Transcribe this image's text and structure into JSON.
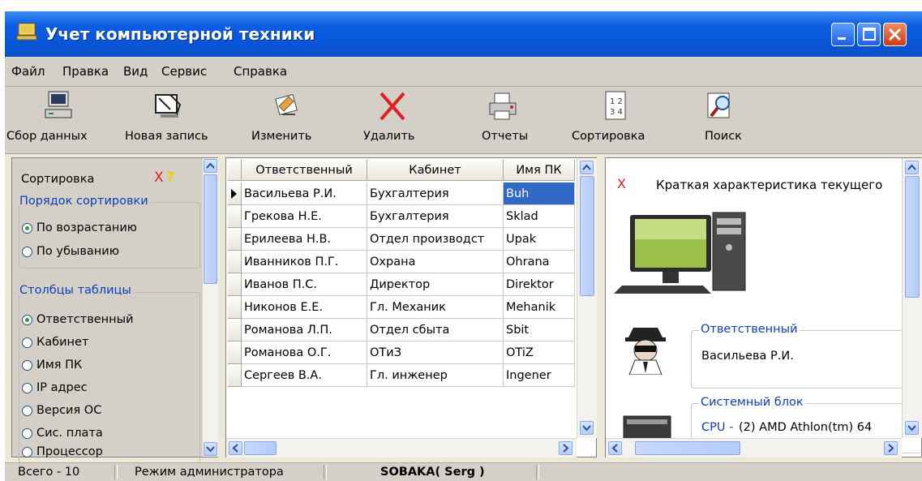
{
  "window": {
    "title": "Учет компьютерной техники"
  },
  "menu": [
    "Файл",
    "Правка",
    "Вид",
    "Сервис",
    "Справка"
  ],
  "toolbar": {
    "collect": "Сбор данных",
    "new": "Новая запись",
    "edit": "Изменить",
    "delete": "Удалить",
    "reports": "Отчеты",
    "sort": "Сортировка",
    "search": "Поиск"
  },
  "sort_panel": {
    "title": "Сортировка",
    "close_mark": "X",
    "help_mark": "?",
    "order_group": "Порядок сортировки",
    "asc": "По возрастанию",
    "desc": "По убыванию",
    "columns_group": "Столбцы таблицы",
    "col_responsible": "Ответственный",
    "col_cabinet": "Кабинет",
    "col_pcname": "Имя ПК",
    "col_ip": "IP адрес",
    "col_os": "Версия ОС",
    "col_board": "Сис. плата",
    "col_cpu": "Процессор"
  },
  "table": {
    "headers": [
      "Ответственный",
      "Кабинет",
      "Имя ПК"
    ],
    "rows": [
      [
        "Васильева Р.И.",
        "Бухгалтерия",
        "Buh"
      ],
      [
        "Грекова Н.Е.",
        "Бухгалтерия",
        "Sklad"
      ],
      [
        "Ерилеева Н.В.",
        "Отдел производст",
        "Upak"
      ],
      [
        "Иванников П.Г.",
        "Охрана",
        "Ohrana"
      ],
      [
        "Иванов П.С.",
        "Директор",
        "Direktor"
      ],
      [
        "Никонов Е.Е.",
        "Гл. Механик",
        "Mehanik"
      ],
      [
        "Романова Л.П.",
        "Отдел сбыта",
        "Sbit"
      ],
      [
        "Романова О.Г.",
        "ОТиЗ",
        "OTiZ"
      ],
      [
        "Сергеев В.А.",
        "Гл. инженер",
        "Ingener"
      ]
    ]
  },
  "details": {
    "close_mark": "X",
    "caption": "Краткая характеристика текущего",
    "responsible_label": "Ответственный",
    "responsible_value": "Васильева Р.И.",
    "sysunit_label": "Системный блок",
    "cpu_label": "CPU -",
    "cpu_value": "(2) AMD Athlon(tm) 64"
  },
  "status": {
    "total": "Всего - 10",
    "mode": "Режим администратора",
    "user": "SOBAKA( Serg )"
  },
  "colors": {
    "title_blue": "#0a5ee4",
    "accent_blue": "#0b3fb8",
    "close_red": "#d33a12",
    "selection": "#316ac5"
  }
}
